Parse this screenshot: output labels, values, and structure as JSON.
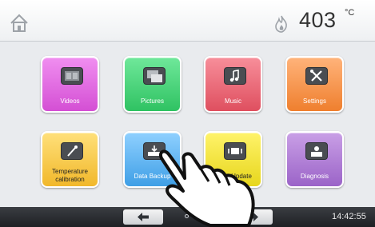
{
  "header": {
    "temperature": "403",
    "temperature_unit": "°C"
  },
  "tiles": [
    {
      "label": "Videos"
    },
    {
      "label": "Pictures"
    },
    {
      "label": "Music"
    },
    {
      "label": "Settings"
    },
    {
      "label": "Temperature calibration"
    },
    {
      "label": "Data Backup"
    },
    {
      "label": "Update"
    },
    {
      "label": "Diagnosis"
    }
  ],
  "footer": {
    "clock": "14:42:55",
    "page_count": 3,
    "current_page": 2
  },
  "icons": {
    "home": "home-icon",
    "flame": "flame-icon",
    "prev": "arrow-left-icon",
    "next": "arrow-right-icon"
  }
}
